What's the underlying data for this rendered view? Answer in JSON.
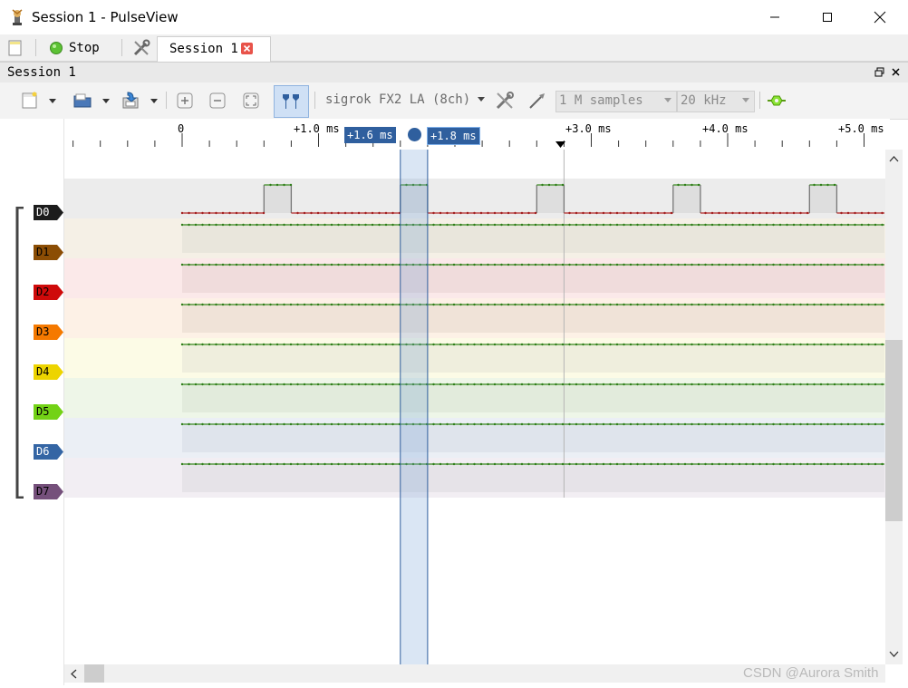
{
  "window": {
    "title": "Session 1 - PulseView"
  },
  "tabbar": {
    "stop_label": "Stop",
    "session_tab": "Session 1"
  },
  "dock": {
    "title": "Session 1"
  },
  "toolbar": {
    "device": "sigrok FX2 LA (8ch)",
    "samples": "1 M samples",
    "samplerate": "20 kHz"
  },
  "ruler": {
    "ticks": [
      "0",
      "+1.0 ms",
      "+3.0 ms",
      "+4.0 ms",
      "+5.0 ms"
    ],
    "cursor_left": "+1.6 ms",
    "cursor_right": "+1.8 ms"
  },
  "channels": [
    {
      "name": "D0",
      "color": "#1c1c1c"
    },
    {
      "name": "D1",
      "color": "#8b4d04"
    },
    {
      "name": "D2",
      "color": "#cf0a0a"
    },
    {
      "name": "D3",
      "color": "#f57900"
    },
    {
      "name": "D4",
      "color": "#edd400"
    },
    {
      "name": "D5",
      "color": "#73d216"
    },
    {
      "name": "D6",
      "color": "#3465a4"
    },
    {
      "name": "D7",
      "color": "#75507b"
    }
  ],
  "signals": {
    "d0_high_intervals_ms": [
      [
        0.6,
        0.8
      ],
      [
        1.6,
        1.8
      ],
      [
        2.6,
        2.8
      ],
      [
        3.6,
        3.8
      ],
      [
        4.6,
        4.8
      ]
    ],
    "other_channels_level": "high"
  },
  "watermark": "CSDN @Aurora Smith"
}
